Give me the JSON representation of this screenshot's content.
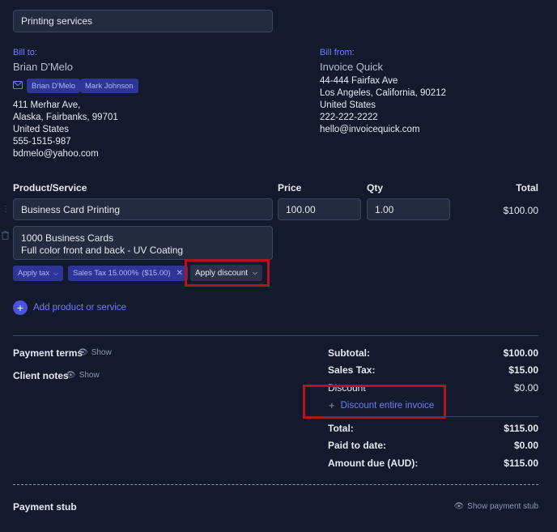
{
  "header": {
    "subject_value": "Printing services"
  },
  "bill_to": {
    "label": "Bill to:",
    "name": "Brian D'Melo",
    "recipients": [
      "Brian D'Melo",
      "Mark Johnson"
    ],
    "address_line1": "411 Merhar Ave,",
    "address_line2": "Alaska, Fairbanks, 99701",
    "country": "United States",
    "phone": "555-1515-987",
    "email": "bdmelo@yahoo.com"
  },
  "bill_from": {
    "label": "Bill from:",
    "name": "Invoice Quick",
    "address_line1": "44-444 Fairfax Ave",
    "address_line2": "Los Angeles, California, 90212",
    "country": "United States",
    "phone": "222-222-2222",
    "email": "hello@invoicequick.com"
  },
  "items_header": {
    "product": "Product/Service",
    "price": "Price",
    "qty": "Qty",
    "total": "Total"
  },
  "item": {
    "name": "Business Card Printing",
    "price": "100.00",
    "qty": "1.00",
    "total": "$100.00",
    "description_line1": "1000 Business Cards",
    "description_line2": "Full color front and back - UV Coating",
    "apply_tax": "Apply tax",
    "tax_chip": "Sales Tax 15.000%",
    "tax_chip_amount": "($15.00)",
    "apply_discount": "Apply discount"
  },
  "add_product": "Add product or service",
  "payment_terms": {
    "label": "Payment terms",
    "show": "Show"
  },
  "client_notes": {
    "label": "Client notes",
    "show": "Show"
  },
  "summary": {
    "subtotal_label": "Subtotal:",
    "subtotal": "$100.00",
    "tax_label": "Sales Tax:",
    "tax": "$15.00",
    "discount_label": "Discount",
    "discount": "$0.00",
    "discount_entire": "Discount entire invoice",
    "total_label": "Total:",
    "total": "$115.00",
    "paid_label": "Paid to date:",
    "paid": "$0.00",
    "due_label": "Amount due (AUD):",
    "due": "$115.00"
  },
  "stub": {
    "label": "Payment stub",
    "show": "Show payment stub"
  },
  "colors": {
    "background": "#141a2e",
    "accent": "#6f7bff",
    "highlight": "#b3141b"
  }
}
